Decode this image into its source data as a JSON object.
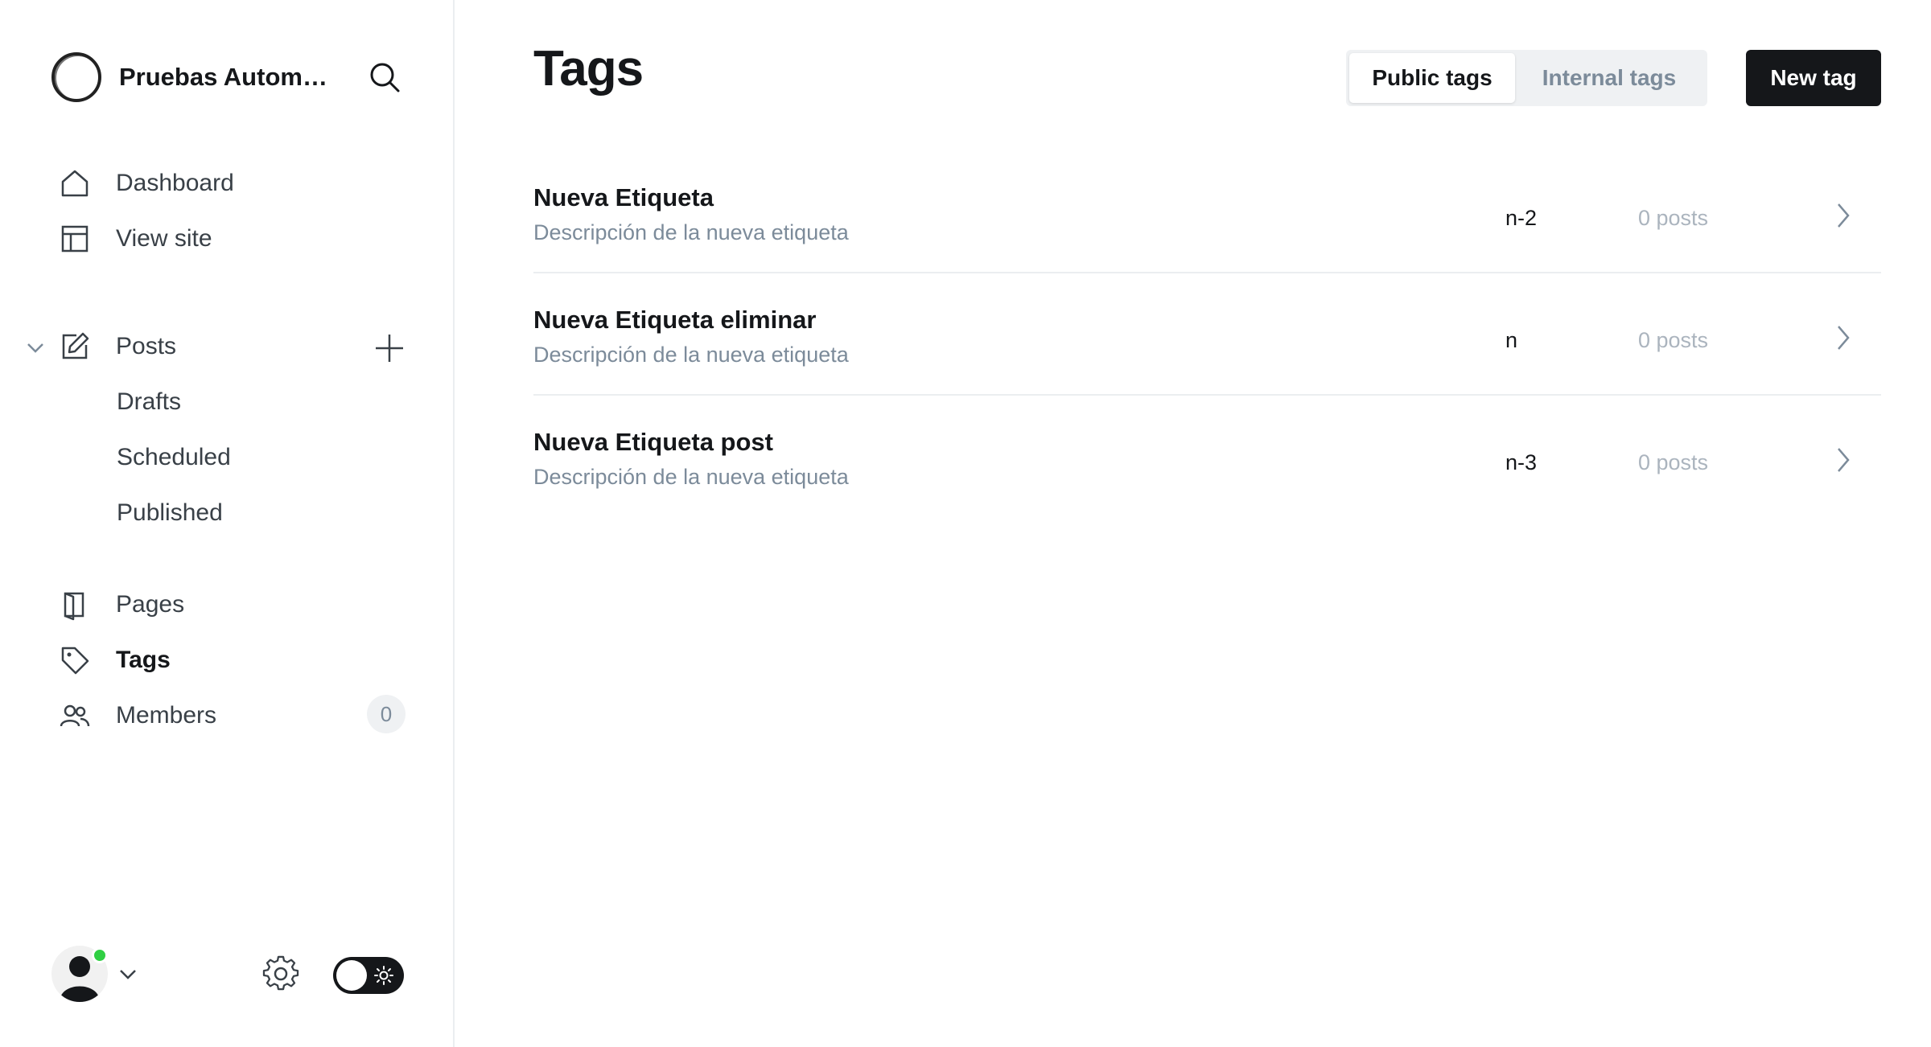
{
  "sidebar": {
    "brand_name": "Pruebas Automa...",
    "nav": {
      "dashboard": "Dashboard",
      "view_site": "View site",
      "posts": "Posts",
      "drafts": "Drafts",
      "scheduled": "Scheduled",
      "published": "Published",
      "pages": "Pages",
      "tags": "Tags",
      "members": "Members",
      "members_count": "0"
    },
    "icons": {
      "brand": "brand-logo-icon",
      "search": "search-icon",
      "dashboard": "home-icon",
      "view_site": "layout-icon",
      "posts": "edit-icon",
      "pages": "page-icon",
      "tags": "tag-icon",
      "members": "members-icon",
      "settings": "gear-icon",
      "theme": "sun-icon"
    }
  },
  "header": {
    "title": "Tags",
    "tabs": [
      "Public tags",
      "Internal tags"
    ],
    "active_tab": "Public tags",
    "new_button": "New tag"
  },
  "tags": [
    {
      "name": "Nueva Etiqueta",
      "description": "Descripción de la nueva etiqueta",
      "slug": "n-2",
      "posts": "0 posts"
    },
    {
      "name": "Nueva Etiqueta eliminar",
      "description": "Descripción de la nueva etiqueta",
      "slug": "n",
      "posts": "0 posts"
    },
    {
      "name": "Nueva Etiqueta post",
      "description": "Descripción de la nueva etiqueta",
      "slug": "n-3",
      "posts": "0 posts"
    }
  ],
  "colors": {
    "primary": "#15171a",
    "muted": "#7c8b9a",
    "status_online": "#30cf43",
    "divider": "#ebeef0"
  }
}
